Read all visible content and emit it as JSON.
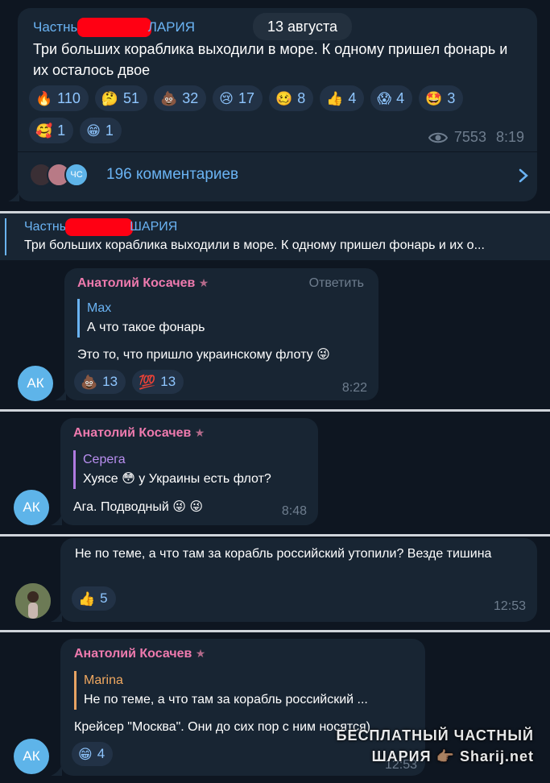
{
  "post": {
    "channel_name_left": "Частны",
    "channel_name_right": "ЛАРИЯ",
    "date_pill": "13 августа",
    "text": "Три больших кораблика выходили в море. К одному пришел фонарь и их осталось двое",
    "reactions": [
      {
        "emoji": "🔥",
        "count": "110"
      },
      {
        "emoji": "🤔",
        "count": "51"
      },
      {
        "emoji": "💩",
        "count": "32"
      },
      {
        "emoji": "😢",
        "count": "17"
      },
      {
        "emoji": "🥴",
        "count": "8"
      },
      {
        "emoji": "👍",
        "count": "4"
      },
      {
        "emoji": "😱",
        "count": "4"
      },
      {
        "emoji": "🤩",
        "count": "3"
      },
      {
        "emoji": "🥰",
        "count": "1"
      },
      {
        "emoji": "😁",
        "count": "1"
      }
    ],
    "views": "7553",
    "time": "8:19",
    "comments_label": "196 комментариев",
    "commenter_badge": "ЧС"
  },
  "reply_header": {
    "channel_left": "Частны",
    "channel_right": "ШАРИЯ",
    "preview": "Три больших кораблика выходили в море. К одному пришел фонарь и их о..."
  },
  "comments": [
    {
      "author": "Анатолий Косачев",
      "avatar": "АК",
      "reply_action": "Ответить",
      "quote_author": "Max",
      "quote_text": "А что такое фонарь",
      "text": "Это то, что пришло украинскому флоту",
      "text_emoji": "😜",
      "reactions": [
        {
          "emoji": "💩",
          "count": "13"
        },
        {
          "emoji": "💯",
          "count": "13"
        }
      ],
      "time": "8:22"
    },
    {
      "author": "Анатолий Косачев",
      "avatar": "АК",
      "quote_author": "Серега",
      "quote_text_before": "Хуясе",
      "quote_emoji": "😳",
      "quote_text_after": "у Украины есть флот?",
      "text": "Ага. Подводный",
      "text_emoji": "😜 😜",
      "time": "8:48"
    },
    {
      "text": "Не по теме, а что там за корабль российский утопили? Везде тишина",
      "reactions": [
        {
          "emoji": "👍",
          "count": "5"
        }
      ],
      "time": "12:53"
    },
    {
      "author": "Анатолий Косачев",
      "avatar": "АК",
      "quote_author": "Marina",
      "quote_text": "Не по теме, а что там за корабль российский ...",
      "text": "Крейсер \"Москва\". Они до сих пор с ним носятся)",
      "reactions": [
        {
          "emoji": "😁",
          "count": "4"
        }
      ],
      "time": "12:53"
    }
  ],
  "watermark": {
    "line1": "БЕСПЛАТНЫЙ ЧАСТНЫЙ",
    "line2": "ШАРИЯ 👉🏽 Sharij.net"
  },
  "colors": {
    "background": "#0e1621",
    "bubble": "#182533",
    "link": "#6ab3f3",
    "author": "#ee7aae",
    "avatar": "#5eb4e9",
    "redaction": "#ff0013"
  }
}
